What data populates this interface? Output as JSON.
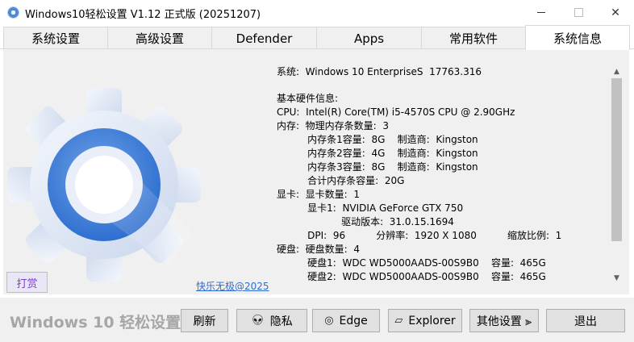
{
  "window": {
    "title": "Windows10轻松设置 V1.12 正式版 (20251207)",
    "minimize_glyph": "",
    "maximize_glyph": "",
    "close_glyph": "✕"
  },
  "tabs": [
    {
      "label": "系统设置"
    },
    {
      "label": "高级设置"
    },
    {
      "label": "Defender"
    },
    {
      "label": "Apps"
    },
    {
      "label": "常用软件"
    },
    {
      "label": "系统信息",
      "active": true
    }
  ],
  "info_lines": [
    "系统:  Windows 10 EnterpriseS  17763.316",
    "",
    "基本硬件信息:",
    "CPU:  Intel(R) Core(TM) i5-4570S CPU @ 2.90GHz",
    "内存:  物理内存条数量:  3",
    "          内存条1容量:  8G    制造商:  Kingston",
    "          内存条2容量:  4G    制造商:  Kingston",
    "          内存条3容量:  8G    制造商:  Kingston",
    "          合计内存条容量:  20G",
    "显卡:  显卡数量:  1",
    "          显卡1:  NVIDIA GeForce GTX 750",
    "                     驱动版本:  31.0.15.1694",
    "          DPI:  96          分辨率:  1920 X 1080          缩放比例:  1",
    "硬盘:  硬盘数量:  4",
    "          硬盘1:  WDC WD5000AADS-00S9B0    容量:  465G",
    "          硬盘2:  WDC WD5000AADS-00S9B0    容量:  465G"
  ],
  "donate_label": "打赏",
  "copyright": "快乐无极@2025",
  "footer": {
    "brand": "Windows 10 轻松设置",
    "refresh": "刷新",
    "privacy": "隐私",
    "edge": "Edge",
    "explorer": "Explorer",
    "other": "其他设置 ⫸",
    "exit": "退出"
  },
  "icons": {
    "app": "gear-icon",
    "privacy": "alien-icon",
    "edge": "edge-icon",
    "explorer": "folder-icon"
  },
  "colors": {
    "gear_blue": "#4a8ad8",
    "gear_light": "#dfe7f5",
    "donate_text": "#7c3fbf",
    "link": "#2f6cd0"
  }
}
